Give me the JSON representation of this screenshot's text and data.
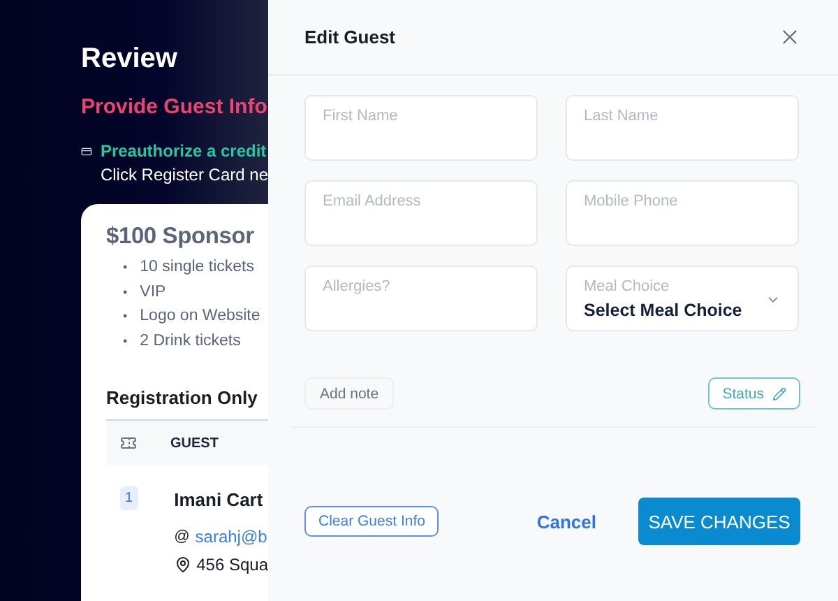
{
  "background": {
    "title": "Review",
    "subtitle": "Provide Guest Info",
    "notice": {
      "heading": "Preauthorize a credit",
      "text": "Click Register Card ne"
    },
    "package": {
      "title": "$100 Sponsor",
      "bullet": "•",
      "perks": [
        "10 single tickets",
        "VIP",
        "Logo on Website",
        "2 Drink tickets"
      ]
    },
    "section": "Registration Only",
    "table": {
      "column": "GUEST",
      "rows": [
        {
          "number": "1",
          "name": "Imani Cart",
          "email_prefix": "@",
          "email": "sarahj@b",
          "address": "456 Squa"
        }
      ]
    }
  },
  "dialog": {
    "title": "Edit Guest",
    "fields": [
      {
        "kind": "text",
        "label": "First Name"
      },
      {
        "kind": "text",
        "label": "Last Name"
      },
      {
        "kind": "text",
        "label": "Email Address"
      },
      {
        "kind": "text",
        "label": "Mobile Phone"
      },
      {
        "kind": "text",
        "label": "Allergies?"
      },
      {
        "kind": "select",
        "label": "Meal Choice",
        "value": "Select Meal Choice"
      }
    ],
    "add_note": "Add note",
    "status": "Status",
    "clear": "Clear Guest Info",
    "cancel": "Cancel",
    "save": "SAVE CHANGES"
  }
}
